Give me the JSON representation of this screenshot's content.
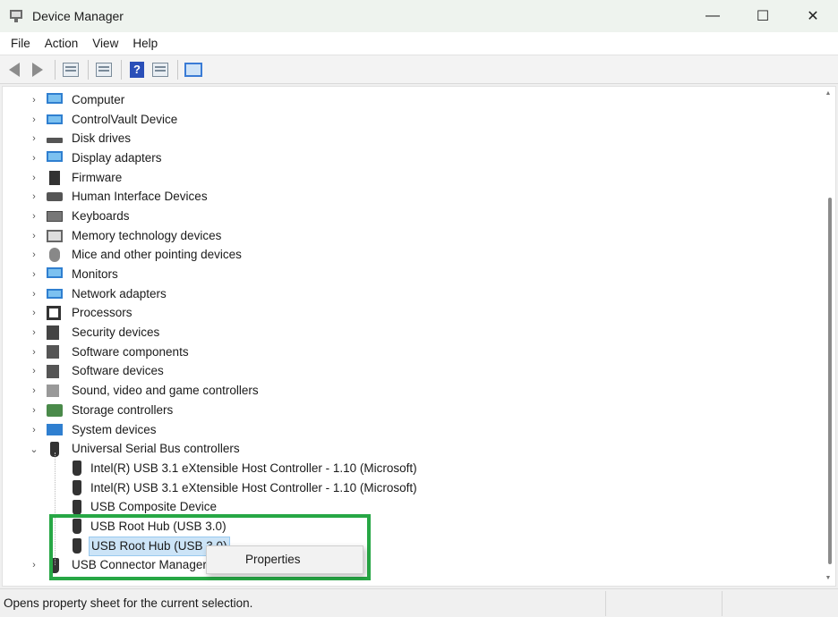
{
  "window": {
    "title": "Device Manager",
    "min_glyph": "—",
    "max_glyph": "☐",
    "close_glyph": "✕"
  },
  "menu": [
    "File",
    "Action",
    "View",
    "Help"
  ],
  "toolbar": {
    "help_glyph": "?"
  },
  "tree": {
    "collapsed_glyph": "›",
    "expanded_glyph": "⌄",
    "categories": [
      {
        "label": "Computer",
        "icon": "computer-icon"
      },
      {
        "label": "ControlVault Device",
        "icon": "controlvault-icon"
      },
      {
        "label": "Disk drives",
        "icon": "disk-drive-icon"
      },
      {
        "label": "Display adapters",
        "icon": "display-adapter-icon"
      },
      {
        "label": "Firmware",
        "icon": "firmware-icon"
      },
      {
        "label": "Human Interface Devices",
        "icon": "hid-icon"
      },
      {
        "label": "Keyboards",
        "icon": "keyboard-icon"
      },
      {
        "label": "Memory technology devices",
        "icon": "memory-icon"
      },
      {
        "label": "Mice and other pointing devices",
        "icon": "mouse-icon"
      },
      {
        "label": "Monitors",
        "icon": "monitor-icon"
      },
      {
        "label": "Network adapters",
        "icon": "network-adapter-icon"
      },
      {
        "label": "Processors",
        "icon": "processor-icon"
      },
      {
        "label": "Security devices",
        "icon": "security-device-icon"
      },
      {
        "label": "Software components",
        "icon": "software-component-icon"
      },
      {
        "label": "Software devices",
        "icon": "software-device-icon"
      },
      {
        "label": "Sound, video and game controllers",
        "icon": "sound-icon"
      },
      {
        "label": "Storage controllers",
        "icon": "storage-controller-icon"
      },
      {
        "label": "System devices",
        "icon": "system-device-icon"
      },
      {
        "label": "Universal Serial Bus controllers",
        "icon": "usb-icon"
      }
    ],
    "usb_children": [
      "Intel(R) USB 3.1 eXtensible Host Controller - 1.10 (Microsoft)",
      "Intel(R) USB 3.1 eXtensible Host Controller - 1.10 (Microsoft)",
      "USB Composite Device",
      "USB Root Hub (USB 3.0)",
      "USB Root Hub (USB 3.0)"
    ],
    "last_category": "USB Connector Managers"
  },
  "context_menu": {
    "properties": "Properties"
  },
  "status": {
    "text": "Opens property sheet for the current selection."
  },
  "colors": {
    "highlight": "#27a745",
    "selection": "#cce4f7"
  }
}
